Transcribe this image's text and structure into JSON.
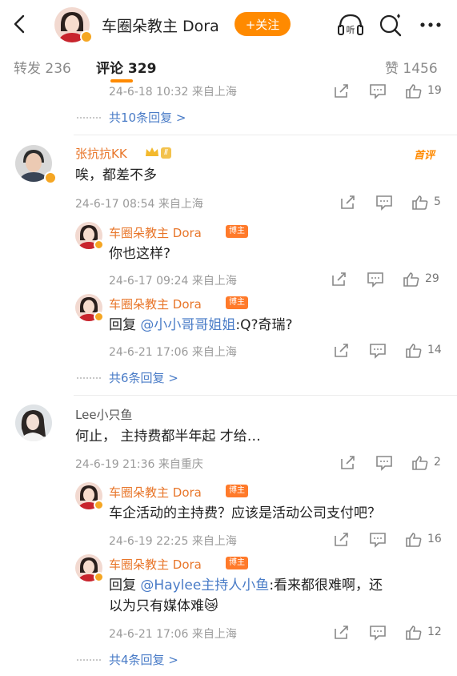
{
  "header": {
    "title": "车圈朵教主 Dora",
    "follow_label": "+关注",
    "listen_label": "听"
  },
  "tabs": {
    "forward": "转发 236",
    "comment": "评论 329",
    "like": "赞 1456"
  },
  "top_partial": {
    "meta": "24-6-18 10:32 来自上海",
    "likes": "19",
    "more_replies": "共10条回复 >"
  },
  "comments": [
    {
      "user": "张抗抗KK",
      "level": "Ⅱ",
      "tag": "首评",
      "text": "唉，都差不多",
      "meta": "24-6-17 08:54 来自上海",
      "likes": "5",
      "replies": [
        {
          "user": "车圈朵教主 Dora",
          "badge": "博主",
          "text": "你也这样?",
          "meta": "24-6-17 09:24 来自上海",
          "likes": "29"
        },
        {
          "user": "车圈朵教主 Dora",
          "badge": "博主",
          "reply_prefix": "回复 ",
          "mention": "@小小哥哥姐姐",
          "text": ":Q?奇瑞?",
          "meta": "24-6-21 17:06 来自上海",
          "likes": "14"
        }
      ],
      "more_replies": "共6条回复 >"
    },
    {
      "user": "Lee小只鱼",
      "text": "何止， 主持费都半年起 才给…",
      "meta": "24-6-19 21:36 来自重庆",
      "likes": "2",
      "replies": [
        {
          "user": "车圈朵教主 Dora",
          "badge": "博主",
          "text": "车企活动的主持费？应该是活动公司支付吧？",
          "meta": "24-6-19 22:25 来自上海",
          "likes": "16"
        },
        {
          "user": "车圈朵教主 Dora",
          "badge": "博主",
          "reply_prefix": "回复 ",
          "mention": "@Haylee主持人小鱼",
          "text": ":看来都很难啊，还",
          "text2": "以为只有媒体难",
          "emoji": "😿",
          "meta": "24-6-21 17:06 来自上海",
          "likes": "12"
        }
      ],
      "more_replies": "共4条回复 >"
    }
  ],
  "colors": {
    "accent": "#ff8a00",
    "name": "#e8762a",
    "link": "#4a7cc7"
  }
}
